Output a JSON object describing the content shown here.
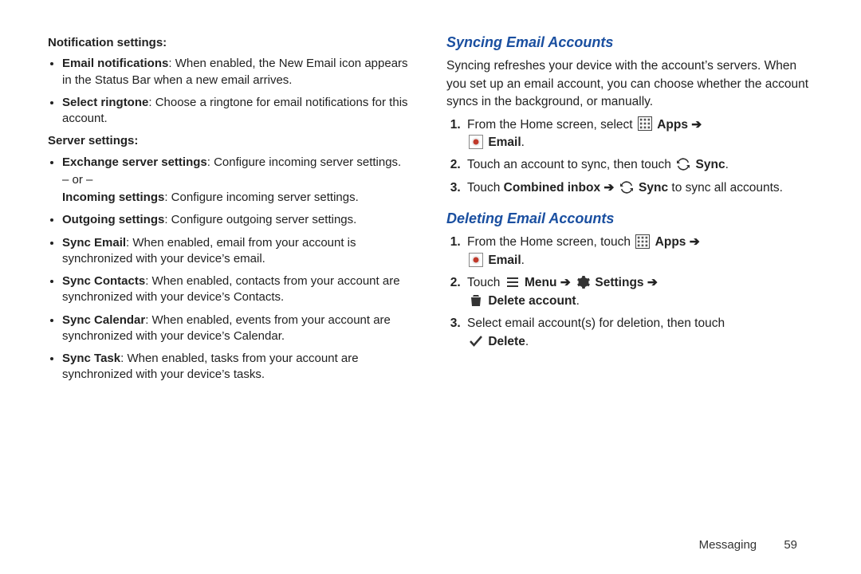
{
  "left": {
    "notif_heading": "Notification settings:",
    "bul1_bold": "Email notifications",
    "bul1_rest": ": When enabled, the New Email icon appears in the Status Bar when a new email arrives.",
    "bul2_bold": "Select ringtone",
    "bul2_rest": ": Choose a ringtone for email notifications for this account.",
    "server_heading": "Server settings:",
    "sv1_bold": "Exchange server settings",
    "sv1_rest": ": Configure incoming server settings.",
    "or": "– or –",
    "sv1b_bold": "Incoming settings",
    "sv1b_rest": ": Configure incoming server settings.",
    "sv2_bold": "Outgoing settings",
    "sv2_rest": ": Configure outgoing server settings.",
    "sv3_bold": "Sync Email",
    "sv3_rest": ": When enabled, email from your account is synchronized with your device’s email.",
    "sv4_bold": "Sync Contacts",
    "sv4_rest": ": When enabled, contacts from your account are synchronized with your device’s Contacts.",
    "sv5_bold": "Sync Calendar",
    "sv5_rest": ": When enabled, events from your account are synchronized with your device’s Calendar.",
    "sv6_bold": "Sync Task",
    "sv6_rest": ": When enabled, tasks from your account are synchronized with your device’s tasks."
  },
  "right": {
    "sync_title": "Syncing Email Accounts",
    "sync_intro": "Syncing refreshes your device with the account’s servers. When you set up an email account, you can choose whether the account syncs in the background, or manually.",
    "s1_pre": "From the Home screen, select ",
    "apps_label": " Apps ",
    "arrow": "➔",
    "email_label": " Email",
    "period": ".",
    "s2_pre": "Touch an account to sync, then touch ",
    "sync_label": " Sync",
    "s3_pre": "Touch ",
    "combined": "Combined inbox ",
    "s3_mid": " to sync all accounts.",
    "del_title": "Deleting Email Accounts",
    "d1_pre": "From the Home screen, touch ",
    "d2_pre": "Touch ",
    "menu_label": " Menu ",
    "settings_label": " Settings ",
    "delete_acct_label": " Delete account",
    "d3_pre": "Select email account(s) for deletion, then touch ",
    "delete_label": " Delete"
  },
  "footer": {
    "section": "Messaging",
    "page": "59"
  }
}
